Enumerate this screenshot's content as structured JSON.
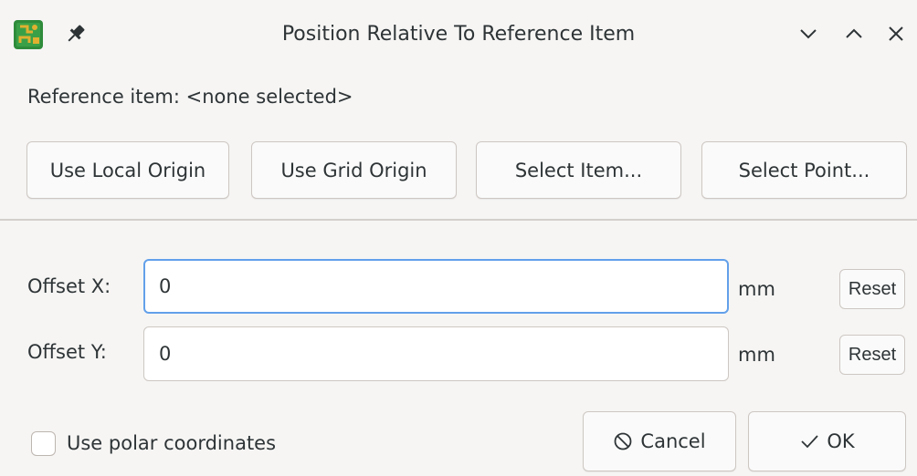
{
  "window": {
    "title": "Position Relative To Reference Item",
    "icons": {
      "app": "pcb-board-icon",
      "pin": "pin-icon",
      "minimize": "chevron-down-icon",
      "maximize": "chevron-up-icon",
      "close": "close-icon"
    }
  },
  "reference": {
    "label": "Reference item: <none selected>"
  },
  "actions": {
    "local_origin": "Use Local Origin",
    "grid_origin": "Use Grid Origin",
    "select_item": "Select Item...",
    "select_point": "Select Point..."
  },
  "offset_x": {
    "label": "Offset X:",
    "value": "0",
    "unit": "mm",
    "reset": "Reset"
  },
  "offset_y": {
    "label": "Offset Y:",
    "value": "0",
    "unit": "mm",
    "reset": "Reset"
  },
  "polar": {
    "label": "Use polar coordinates",
    "checked": false
  },
  "footer": {
    "cancel": "Cancel",
    "ok": "OK"
  },
  "colors": {
    "accent": "#62a0ea",
    "background": "#f6f5f4",
    "pcb_green": "#2e8b3a",
    "pcb_gold": "#e0b030"
  }
}
